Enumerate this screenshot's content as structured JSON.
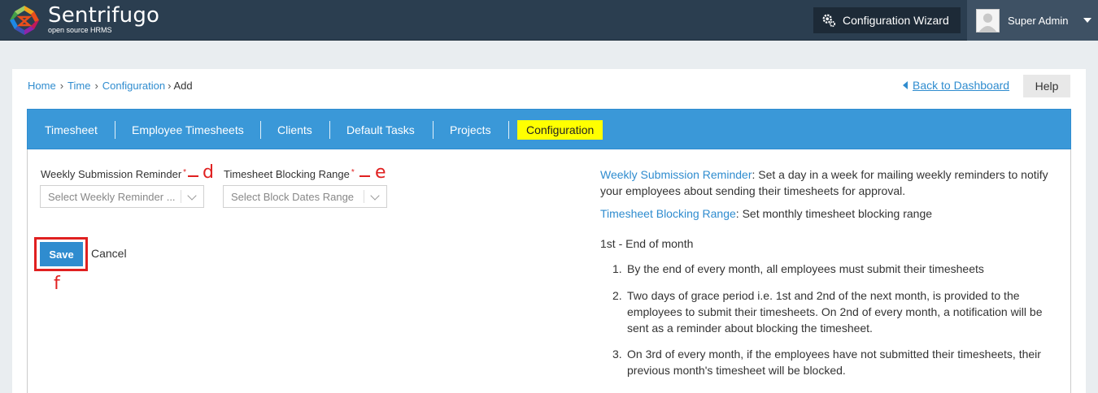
{
  "header": {
    "brand": "Sentrifugo",
    "brand_sub": "open source HRMS",
    "wizard_label": "Configuration Wizard",
    "user_name": "Super Admin"
  },
  "breadcrumb": {
    "home": "Home",
    "time": "Time",
    "configuration": "Configuration",
    "current": "Add",
    "separator": "›"
  },
  "actions": {
    "back_label": "Back to Dashboard",
    "help_label": "Help"
  },
  "tabs": [
    {
      "label": "Timesheet"
    },
    {
      "label": "Employee Timesheets"
    },
    {
      "label": "Clients"
    },
    {
      "label": "Default Tasks"
    },
    {
      "label": "Projects"
    },
    {
      "label": "Configuration"
    }
  ],
  "form": {
    "weekly_label": "Weekly Submission Reminder",
    "weekly_placeholder": "Select Weekly Reminder ...",
    "blocking_label": "Timesheet Blocking Range",
    "blocking_placeholder": "Select Block Dates Range",
    "required_mark": "*",
    "save_label": "Save",
    "cancel_label": "Cancel"
  },
  "annotations": {
    "d": "d",
    "e": "e",
    "f": "f"
  },
  "help": {
    "weekly_term": "Weekly Submission Reminder",
    "weekly_desc": ": Set a day in a week for mailing weekly reminders to notify your employees about sending their timesheets for approval.",
    "blocking_term": "Timesheet Blocking Range",
    "blocking_desc": ": Set monthly timesheet blocking range",
    "subheading": "1st - End of month",
    "rules": [
      {
        "num": "1.",
        "text": "By the end of every month, all employees must submit their timesheets"
      },
      {
        "num": "2.",
        "text": "Two days of grace period i.e. 1st and 2nd of the next month, is provided to the employees to submit their timesheets. On 2nd of every month, a notification will be sent as a reminder about blocking the timesheet."
      },
      {
        "num": "3.",
        "text": "On 3rd of every month, if the employees have not submitted their timesheets, their previous month's timesheet will be blocked."
      }
    ]
  },
  "colors": {
    "header_bg": "#2b3e50",
    "tab_bar": "#3a98d8",
    "active_tab_highlight": "#ffff00",
    "link": "#2f8ccf",
    "annotation": "#e02020"
  }
}
